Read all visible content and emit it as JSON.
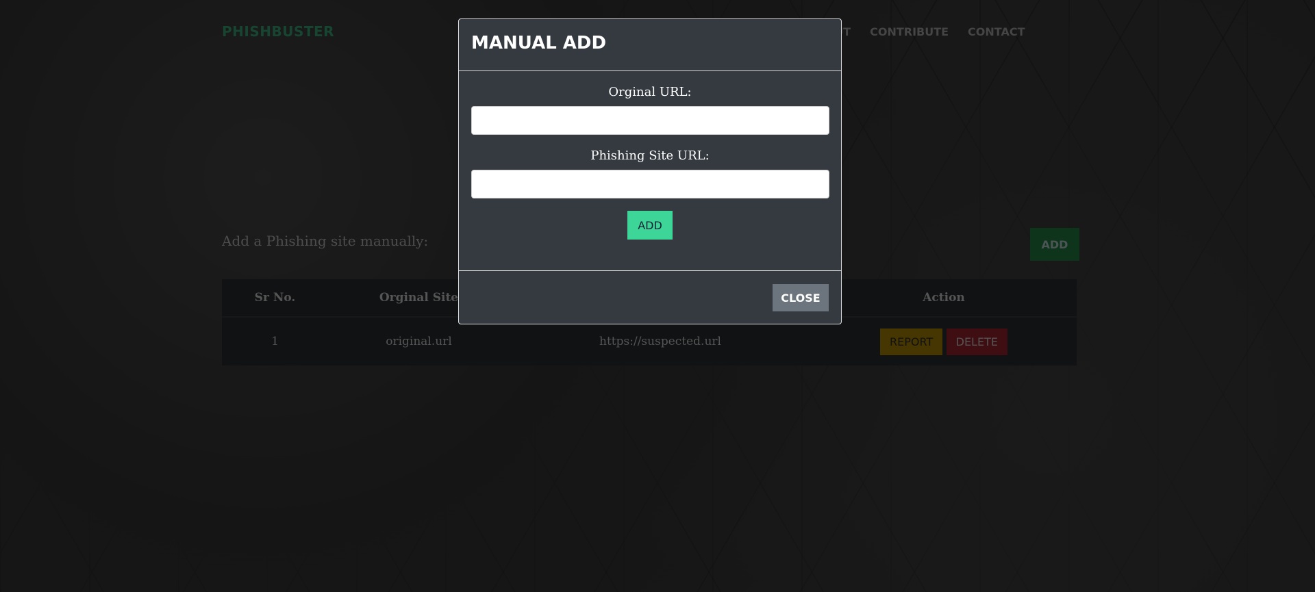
{
  "nav": {
    "brand": "PHISHBUSTER",
    "items": [
      "ABOUT",
      "CONTRIBUTE",
      "CONTACT"
    ]
  },
  "main": {
    "lead": "Add a Phishing site manually:",
    "add_label": "ADD",
    "table": {
      "headers": [
        "Sr No.",
        "Orginal Site",
        "",
        "Action"
      ],
      "rows": [
        {
          "sr": "1",
          "original": "original.url",
          "phishing": "https://suspected.url",
          "report": "REPORT",
          "delete": "DELETE"
        }
      ]
    }
  },
  "modal": {
    "title": "MANUAL ADD",
    "original_label": "Orginal URL:",
    "original_value": "",
    "phishing_label": "Phishing Site URL:",
    "phishing_value": "",
    "add_label": "ADD",
    "close_label": "CLOSE"
  }
}
